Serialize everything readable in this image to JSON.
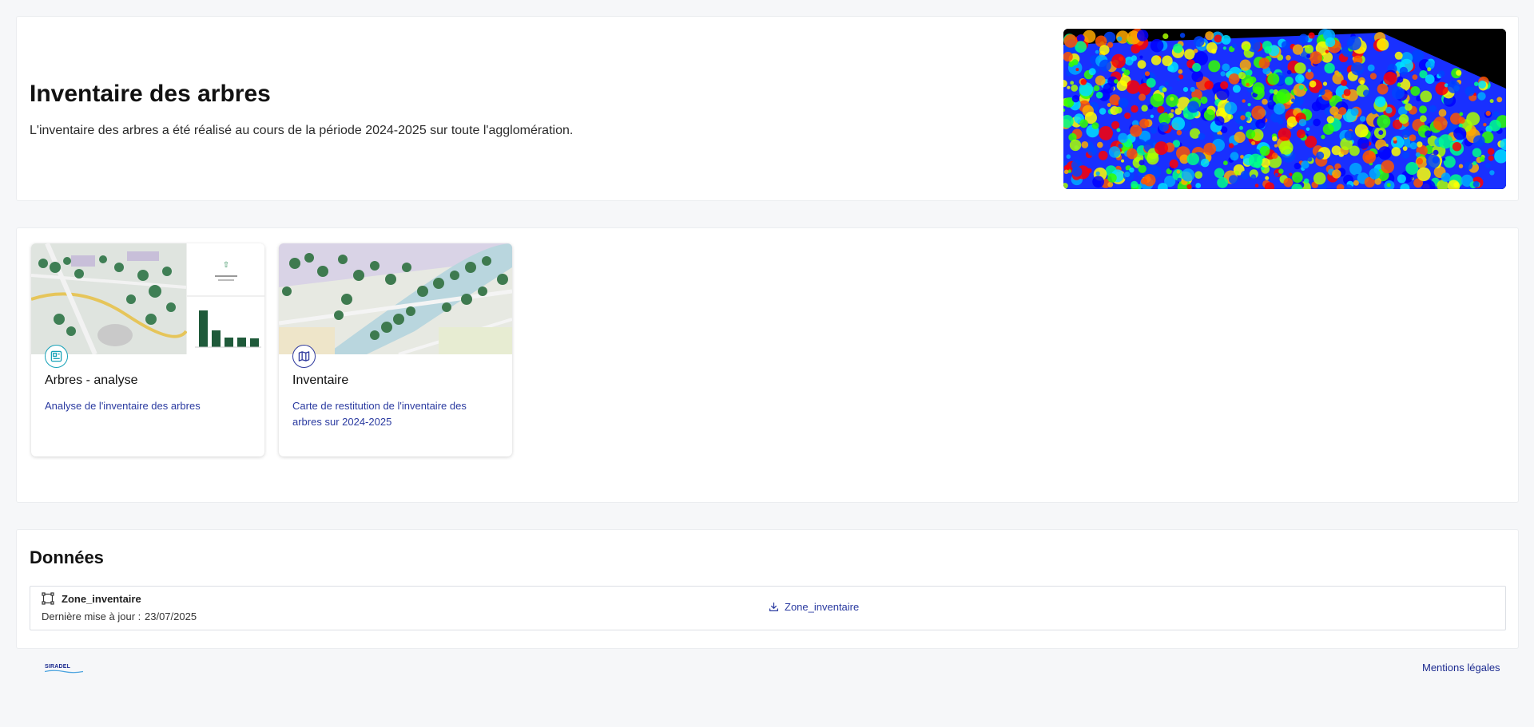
{
  "header": {
    "title": "Inventaire des arbres",
    "description": "L'inventaire des arbres a été réalisé au cours de la période 2024-2025 sur toute l'agglomération."
  },
  "apps": [
    {
      "title": "Arbres - analyse",
      "description": "Analyse de l'inventaire des arbres",
      "icon": "dashboard-icon",
      "icon_color": "#17a2b8"
    },
    {
      "title": "Inventaire",
      "description": "Carte de restitution de l'inventaire des arbres sur 2024-2025",
      "icon": "map-icon",
      "icon_color": "#2f3a9e"
    }
  ],
  "data_section": {
    "title": "Données",
    "items": [
      {
        "name": "Zone_inventaire",
        "updated_label": "Dernière mise à jour :",
        "updated_value": "23/07/2025",
        "download_label": "Zone_inventaire",
        "icon": "polygon-icon"
      }
    ]
  },
  "footer": {
    "logo_text": "SIRADEL",
    "legal_link": "Mentions légales"
  },
  "colors": {
    "accent": "#1b2a8f",
    "link": "#2a3aa0",
    "teal": "#17a2b8",
    "background": "#f6f7f9"
  }
}
